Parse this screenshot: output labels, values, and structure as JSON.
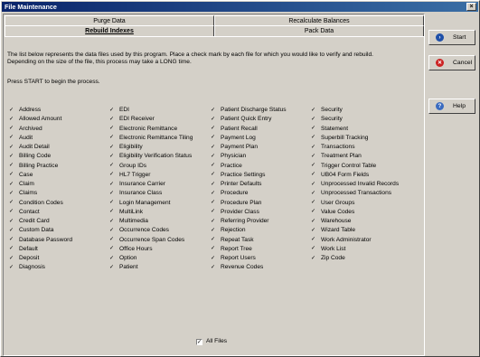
{
  "window": {
    "title": "File Maintenance",
    "close_glyph": "×"
  },
  "tabs": [
    {
      "label": "Purge Data"
    },
    {
      "label": "Recalculate Balances"
    },
    {
      "label": "Rebuild Indexes"
    },
    {
      "label": "Pack Data"
    }
  ],
  "instructions": {
    "line1": "The list below represents the data files used by this program.  Place a check mark by each file for which you would like to verify and rebuild.",
    "line2": "Depending on the size of the file, this process may take a LONG time.",
    "press_start": "Press START to begin the process."
  },
  "check_glyph": "✓",
  "files": {
    "col1": [
      "Address",
      "Allowed Amount",
      "Archived",
      "Audit",
      "Audit Detail",
      "Billing Code",
      "Billing Practice",
      "Case",
      "Claim",
      "Claims",
      "Condition Codes",
      "Contact",
      "Credit Card",
      "Custom Data",
      "Database Password",
      "Default",
      "Deposit",
      "Diagnosis"
    ],
    "col2": [
      "EDI",
      "EDI Receiver",
      "Electronic Remittance",
      "Electronic Remittance Tiling",
      "Eligibility",
      "Eligibility Verification Status",
      "Group IDs",
      "HL7 Trigger",
      "Insurance Carrier",
      "Insurance Class",
      "Login Management",
      "MultiLink",
      "Multimedia",
      "Occurrence Codes",
      "Occurrence Span Codes",
      "Office Hours",
      "Option",
      "Patient"
    ],
    "col3": [
      "Patient Discharge Status",
      "Patient Quick Entry",
      "Patient Recall",
      "Payment Log",
      "Payment Plan",
      "Physician",
      "Practice",
      "Practice Settings",
      "Printer Defaults",
      "Procedure",
      "Procedure Plan",
      "Provider Class",
      "Referring Provider",
      "Rejection",
      "Repeat Task",
      "Report Tree",
      "Report Users",
      "Revenue Codes"
    ],
    "col4": [
      "Security",
      "Security",
      "Statement",
      "Superbill Tracking",
      "Transactions",
      "Treatment Plan",
      "Trigger Control Table",
      "UB04 Form Fields",
      "Unprocessed Invalid Records",
      "Unprocessed Transactions",
      "User Groups",
      "Value Codes",
      "Warehouse",
      "Wizard Table",
      "Work Administrator",
      "Work List",
      "Zip Code"
    ]
  },
  "all_files_label": "All Files",
  "buttons": {
    "start": "Start",
    "cancel": "Cancel",
    "help": "Help"
  },
  "colors": {
    "start_icon": "#1e4fa8",
    "cancel_icon": "#cc2222",
    "help_icon": "#3b6cc0"
  }
}
